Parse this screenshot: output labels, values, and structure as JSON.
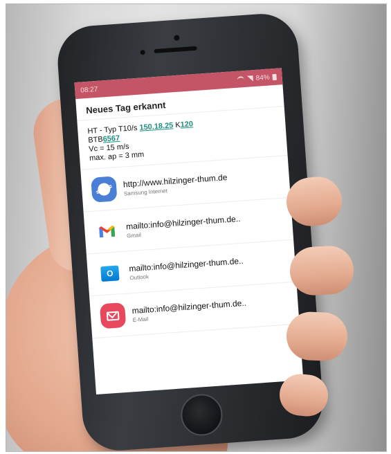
{
  "status_bar": {
    "time": "08:27",
    "battery": "84%"
  },
  "dialog": {
    "title": "Neues Tag erkannt"
  },
  "tag": {
    "line1_prefix": "HT - Typ T10/s",
    "line1_link1": "150.18.25",
    "line1_k": "K",
    "line1_link2": "120",
    "line2_prefix": "BTB",
    "line2_link": "6567",
    "line3": "Vc = 15 m/s",
    "line4": "max. ap = 3 mm"
  },
  "apps": [
    {
      "main": "http://www.hilzinger-thum.de",
      "sub": "Samsung Internet",
      "icon": "samsung-internet-icon"
    },
    {
      "main": "mailto:info@hilzinger-thum.de..",
      "sub": "Gmail",
      "icon": "gmail-icon"
    },
    {
      "main": "mailto:info@hilzinger-thum.de..",
      "sub": "Outlook",
      "icon": "outlook-icon"
    },
    {
      "main": "mailto:info@hilzinger-thum.de..",
      "sub": "E-Mail",
      "icon": "email-icon"
    }
  ],
  "colors": {
    "status_bar": "#c45566",
    "link": "#1f8f80",
    "email_icon": "#e8485d",
    "samsung_icon": "#4a7fd6"
  }
}
